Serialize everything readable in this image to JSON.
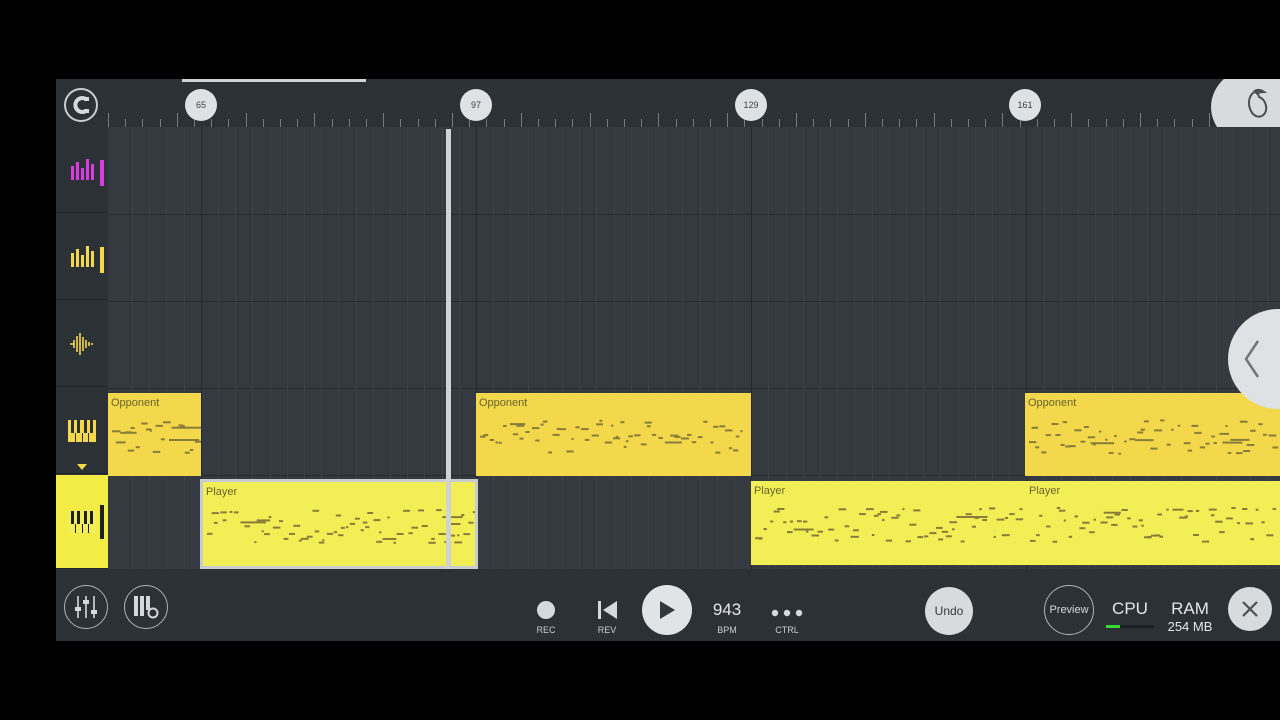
{
  "timeline": {
    "markers": [
      "65",
      "97",
      "129",
      "161"
    ]
  },
  "tracks": [
    {
      "icon": "mixer-bars-icon",
      "color": "#d63ce0",
      "active": false
    },
    {
      "icon": "mixer-bars-icon",
      "color": "#f2d84a",
      "active": false
    },
    {
      "icon": "waveform-icon",
      "color": "#f2d84a",
      "active": false
    },
    {
      "icon": "piano-keys-icon",
      "color": "#f2d84a",
      "active": false
    },
    {
      "icon": "piano-keys-icon",
      "color": "#f2ee56",
      "active": true
    }
  ],
  "clips": {
    "opponent_label": "Opponent",
    "player_label": "Player"
  },
  "toolbar": {
    "rec_label": "REC",
    "rev_label": "REV",
    "bpm_value": "943",
    "bpm_label": "BPM",
    "ctrl_label": "CTRL",
    "undo_label": "Undo",
    "preview_label": "Preview",
    "cpu_label": "CPU",
    "ram_label": "RAM",
    "ram_value": "254 MB",
    "cpu_level": 0.3
  },
  "colors": {
    "opponent_clip": "#f2d84a",
    "player_clip": "#f2ee56",
    "cpu_meter": "#38d630"
  }
}
